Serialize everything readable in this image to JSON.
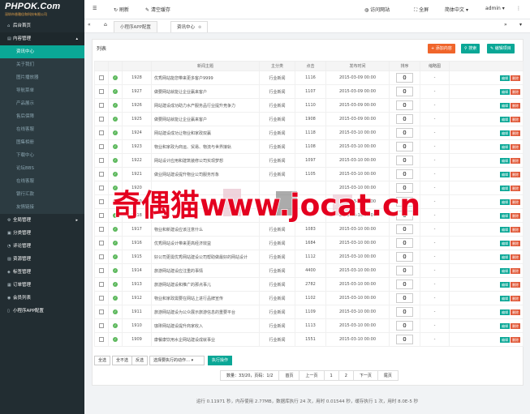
{
  "brand": {
    "logo": "PHPOK.Com",
    "subtitle": "深圳市香雅佳和科技有限公司"
  },
  "sidebar": {
    "home": "后台首页",
    "content": "内容管理",
    "content_items": [
      "资讯中心",
      "关于我们",
      "图片播放器",
      "导航菜单",
      "产品展示",
      "售后保障",
      "在线客服",
      "图集相册",
      "下载中心",
      "论坛BBS",
      "在线客服",
      "银行汇款",
      "友情链接"
    ],
    "groups": [
      "全局管理",
      "分类管理",
      "评论管理",
      "资源管理",
      "标签管理",
      "订单管理",
      "会员列表",
      "小程序APP配置"
    ]
  },
  "topbar": {
    "refresh": "刷新",
    "clear_cache": "清空缓存",
    "visit": "访问网站",
    "fullscreen": "全屏",
    "language": "简体中文",
    "user": "admin"
  },
  "tabs": [
    "小程序APP配置",
    "资讯中心"
  ],
  "panel": {
    "title": "列表",
    "add": "添加内容",
    "search": "搜索",
    "edit_project": "编辑项目"
  },
  "columns": [
    "新闻主题",
    "主分类",
    "点击",
    "发布时间",
    "排序",
    "缩略图"
  ],
  "row_actions": {
    "edit": "编辑",
    "delete": "删除"
  },
  "rows": [
    {
      "id": "1928",
      "title": "优秀网站能您带来更多客户9999",
      "cat": "行业新闻",
      "hits": "1116",
      "date": "2015-03-09 00:00",
      "sort": "0",
      "thumb": "-"
    },
    {
      "id": "1927",
      "title": "做要网站就能让企业赢来客户",
      "cat": "行业新闻",
      "hits": "1107",
      "date": "2015-03-09 00:00",
      "sort": "0",
      "thumb": "-"
    },
    {
      "id": "1926",
      "title": "网站建设成功助力水产服务品行业提升竞争力",
      "cat": "行业新闻",
      "hits": "1110",
      "date": "2015-03-09 00:00",
      "sort": "0",
      "thumb": "-"
    },
    {
      "id": "1925",
      "title": "做要网站就能让企业赢来客户",
      "cat": "行业新闻",
      "hits": "1908",
      "date": "2015-03-09 00:00",
      "sort": "0",
      "thumb": "-"
    },
    {
      "id": "1924",
      "title": "网站建设成功让物业和家政双赢",
      "cat": "行业新闻",
      "hits": "1118",
      "date": "2015-03-10 00:00",
      "sort": "0",
      "thumb": "-"
    },
    {
      "id": "1923",
      "title": "物业和家政为商运、贸易、物流与世界接轨",
      "cat": "行业新闻",
      "hits": "1108",
      "date": "2015-03-10 00:00",
      "sort": "0",
      "thumb": "-"
    },
    {
      "id": "1922",
      "title": "网站设计应用和建筑装修公司实现梦想",
      "cat": "行业新闻",
      "hits": "1097",
      "date": "2015-03-10 00:00",
      "sort": "0",
      "thumb": "-"
    },
    {
      "id": "1921",
      "title": "做业网站建设提升物业公司服务形象",
      "cat": "行业新闻",
      "hits": "1105",
      "date": "2015-03-10 00:00",
      "sort": "0",
      "thumb": "-"
    },
    {
      "id": "1920",
      "title": "",
      "cat": "",
      "hits": "",
      "date": "2015-03-10 00:00",
      "sort": "0",
      "thumb": "-"
    },
    {
      "id": "1919",
      "title": "",
      "cat": "",
      "hits": "",
      "date": "2015-03-10 00:00",
      "sort": "0",
      "thumb": "-"
    },
    {
      "id": "1918",
      "title": "",
      "cat": "",
      "hits": "",
      "date": "2015-03-10 00:00",
      "sort": "0",
      "thumb": "-"
    },
    {
      "id": "1917",
      "title": "物业和新建设应该注意什么",
      "cat": "行业新闻",
      "hits": "1083",
      "date": "2015-03-10 00:00",
      "sort": "0",
      "thumb": "-"
    },
    {
      "id": "1916",
      "title": "优秀网站设计带来更高经济效益",
      "cat": "行业新闻",
      "hits": "1684",
      "date": "2015-03-10 00:00",
      "sort": "0",
      "thumb": "-"
    },
    {
      "id": "1915",
      "title": "好公司更需优秀网站建设公司帮助做最好的网站设计",
      "cat": "行业新闻",
      "hits": "1112",
      "date": "2015-03-10 00:00",
      "sort": "0",
      "thumb": "-"
    },
    {
      "id": "1914",
      "title": "旅游网站建设应注重的事情",
      "cat": "行业新闻",
      "hits": "4400",
      "date": "2015-03-10 00:00",
      "sort": "0",
      "thumb": "-"
    },
    {
      "id": "1913",
      "title": "旅游网站建设和推广的那点事儿",
      "cat": "行业新闻",
      "hits": "2782",
      "date": "2015-03-10 00:00",
      "sort": "0",
      "thumb": "-"
    },
    {
      "id": "1912",
      "title": "物业和家政需要在网站上进行品牌宣传",
      "cat": "行业新闻",
      "hits": "1102",
      "date": "2015-03-10 00:00",
      "sort": "0",
      "thumb": "-"
    },
    {
      "id": "1911",
      "title": "旅游网站建设为公众展示旅游信息的重要平台",
      "cat": "行业新闻",
      "hits": "1109",
      "date": "2015-03-10 00:00",
      "sort": "0",
      "thumb": "-"
    },
    {
      "id": "1910",
      "title": "珈琲网站建设提升商家收入",
      "cat": "行业新闻",
      "hits": "1113",
      "date": "2015-03-10 00:00",
      "sort": "0",
      "thumb": "-"
    },
    {
      "id": "1909",
      "title": "康餐康饮用水企网站建设成就事业",
      "cat": "行业新闻",
      "hits": "1551",
      "date": "2015-03-10 00:00",
      "sort": "0",
      "thumb": "-"
    }
  ],
  "bulk": {
    "all": "全选",
    "none": "全不选",
    "invert": "反选",
    "select_placeholder": "选择要执行的动作…",
    "run": "执行操作"
  },
  "pager": {
    "summary": "数量：33/20，页码：1/2",
    "first": "首页",
    "prev": "上一页",
    "p1": "1",
    "p2": "2",
    "next": "下一页",
    "last": "尾页"
  },
  "footer": "运行 0.11971 秒，内存使用 2.77MB，数据库执行 24 次，用时 0.01544 秒，缓存执行 1 次，用时 8.0E-5 秒",
  "watermark": "奇偶猫www.jocat.cn",
  "colors": {
    "sidebar": "#222d32",
    "accent": "#0aa796",
    "add": "#f0652b",
    "watermark": "#e4001f"
  }
}
